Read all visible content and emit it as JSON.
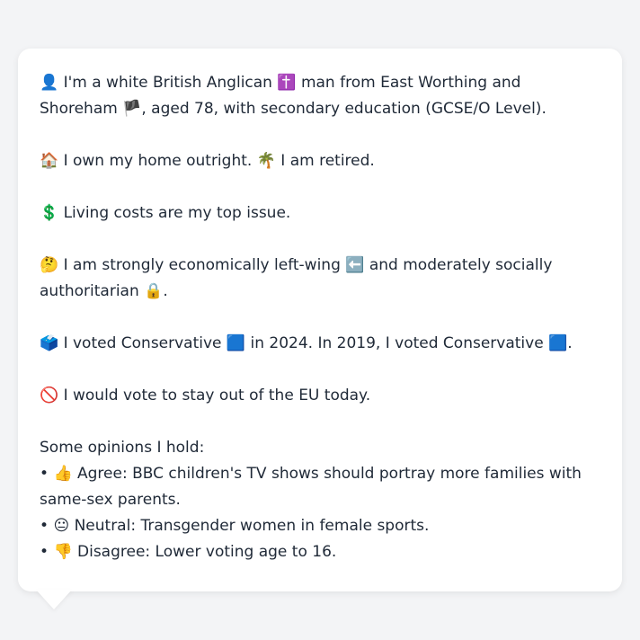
{
  "profile": {
    "line1": {
      "icon1": "👤",
      "text1": " I'm a white British Anglican ",
      "icon2": "✝️",
      "text2": " man from East Worthing and Shoreham ",
      "icon3": "🏴",
      "text3": ", aged 78, with secondary education (GCSE/O Level)."
    },
    "line2": {
      "icon1": "🏠",
      "text1": " I own my home outright. ",
      "icon2": "🌴",
      "text2": " I am retired."
    },
    "line3": {
      "icon1": "💲",
      "text1": " Living costs are my top issue."
    },
    "line4": {
      "icon1": "🤔",
      "text1": " I am strongly economically left-wing ",
      "icon2": "⬅️",
      "text2": " and moderately socially authoritarian ",
      "icon3": "🔒",
      "text3": "."
    },
    "line5": {
      "icon1": "🗳️",
      "text1": " I voted Conservative ",
      "icon2": "🟦",
      "text2": " in 2024. In 2019, I voted Conservative ",
      "icon3": "🟦",
      "text3": "."
    },
    "line6": {
      "icon1": "🚫",
      "text1": " I would vote to stay out of the EU today."
    },
    "opinions": {
      "heading": "Some opinions I hold:",
      "items": [
        {
          "bullet": "• ",
          "icon": "👍",
          "text": " Agree: BBC children's TV shows should portray more families with same-sex parents."
        },
        {
          "bullet": "• ",
          "icon": "😐",
          "text": " Neutral: Transgender women in female sports."
        },
        {
          "bullet": "• ",
          "icon": "👎",
          "text": " Disagree: Lower voting age to 16."
        }
      ]
    }
  }
}
